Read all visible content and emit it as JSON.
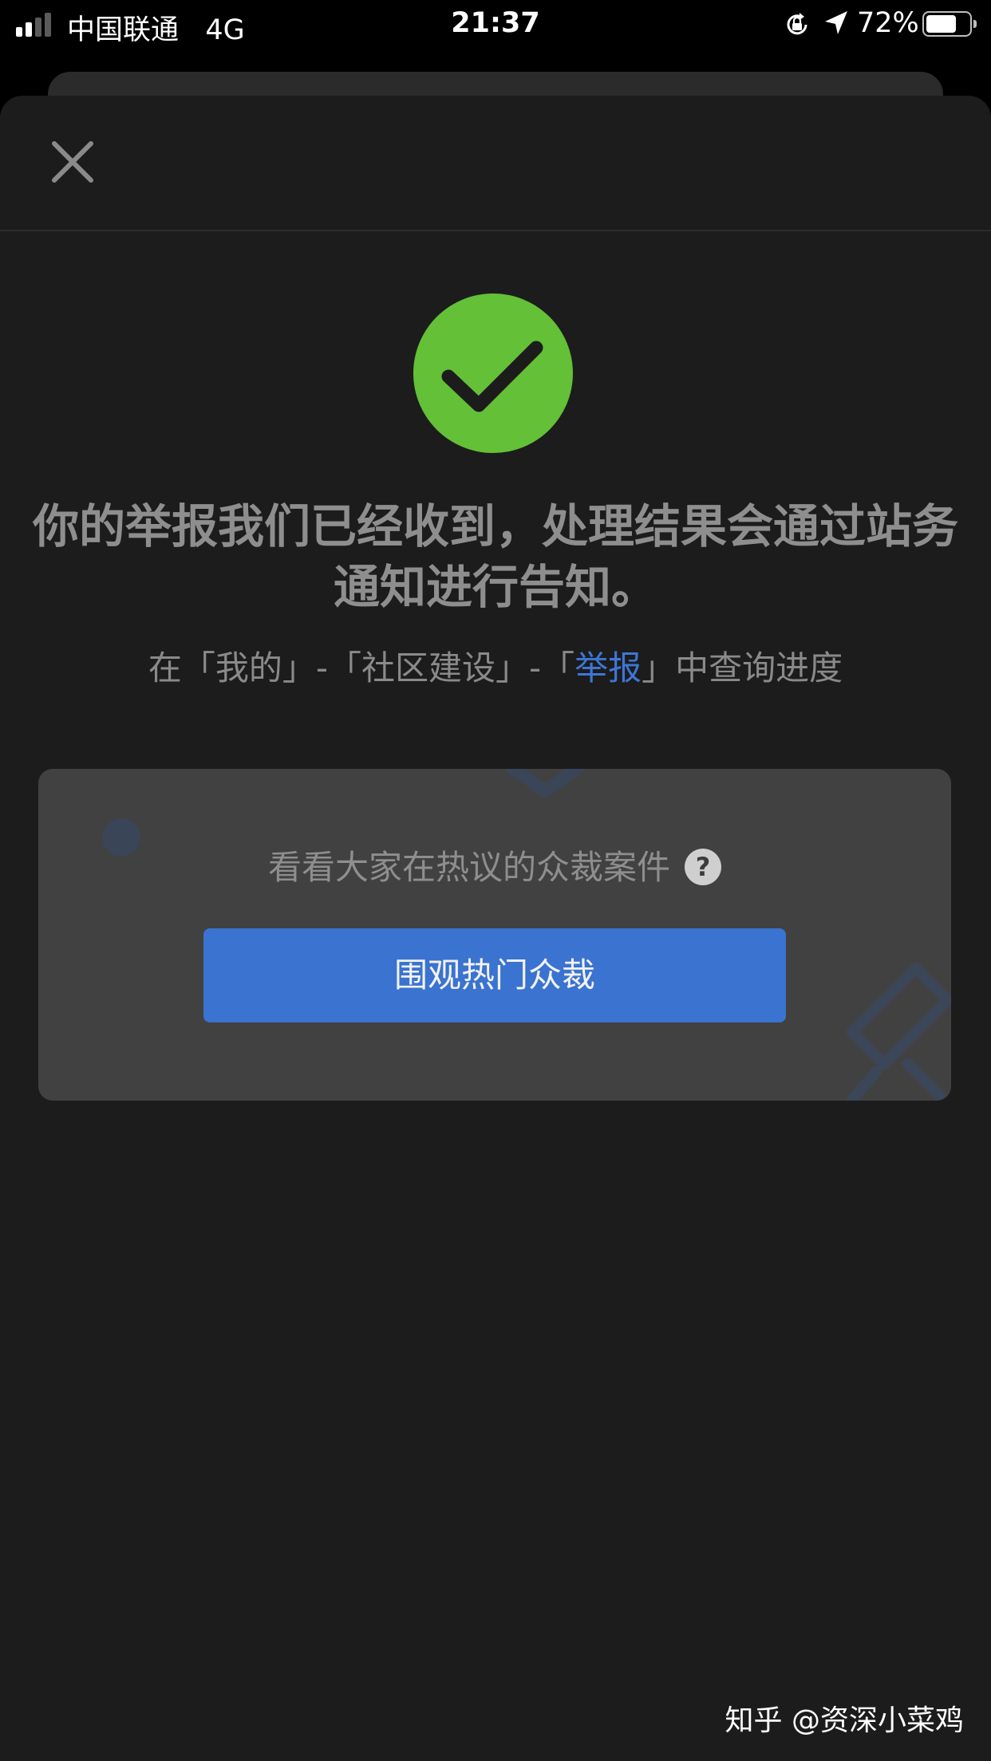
{
  "status_bar": {
    "carrier": "中国联通",
    "network": "4G",
    "time": "21:37",
    "battery_percent": "72%",
    "battery_level": 0.72,
    "signal_bars": 2,
    "signal_bars_total": 4,
    "icons": [
      "signal-icon",
      "rotation-lock-icon",
      "location-arrow-icon",
      "battery-icon"
    ]
  },
  "header": {
    "close_icon": "close-icon"
  },
  "result": {
    "icon": "checkmark-circle-icon",
    "message": "你的举报我们已经收到，处理结果会通过站务通知进行告知。",
    "hint_prefix": "在「我的」-「社区建设」-「",
    "hint_link": "举报",
    "hint_suffix": "」中查询进度"
  },
  "jury_card": {
    "prompt": "看看大家在热议的众裁案件",
    "help_icon": "?",
    "button_label": "围观热门众裁"
  },
  "watermark": "知乎 @资深小菜鸡",
  "colors": {
    "background": "#1c1c1c",
    "success_green": "#64c037",
    "link_blue": "#3d76d6",
    "button_blue": "#3a73d0",
    "card_bg": "#414141"
  }
}
